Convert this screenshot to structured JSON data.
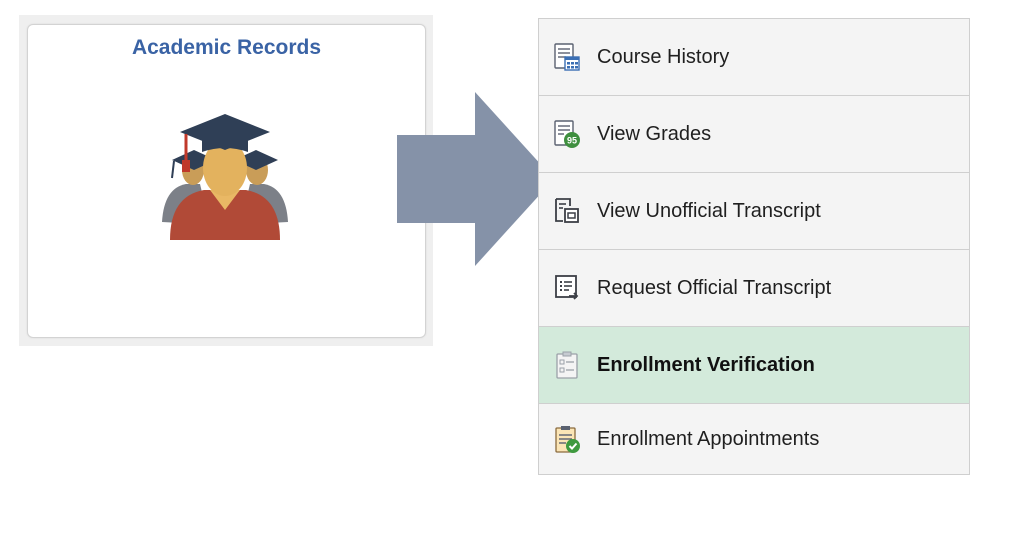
{
  "tile": {
    "title": "Academic Records",
    "icon": "graduates-icon"
  },
  "arrow": {
    "icon": "right-arrow-icon",
    "color": "#8592a8"
  },
  "menu": {
    "selected_bg": "#d3eadb",
    "items": [
      {
        "label": "Course History",
        "icon": "course-history-icon",
        "selected": false
      },
      {
        "label": "View Grades",
        "icon": "grades-icon",
        "badge": "95",
        "selected": false
      },
      {
        "label": "View Unofficial Transcript",
        "icon": "unofficial-transcript-icon",
        "selected": false
      },
      {
        "label": "Request Official Transcript",
        "icon": "request-transcript-icon",
        "selected": false
      },
      {
        "label": "Enrollment Verification",
        "icon": "enrollment-verification-icon",
        "selected": true
      },
      {
        "label": "Enrollment Appointments",
        "icon": "enrollment-appointments-icon",
        "selected": false
      }
    ]
  }
}
